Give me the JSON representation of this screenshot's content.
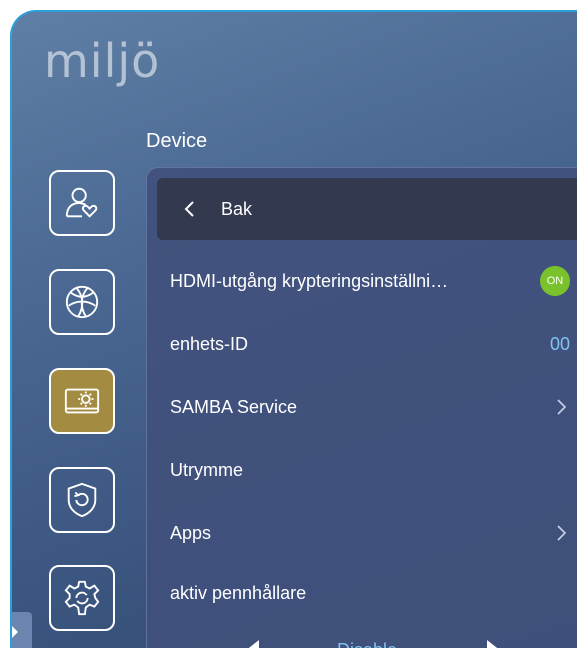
{
  "app": {
    "title": "miljö"
  },
  "section": {
    "title": "Device"
  },
  "sidebar": {
    "items": [
      {
        "name": "user-heart-icon",
        "active": false
      },
      {
        "name": "globe-network-icon",
        "active": false
      },
      {
        "name": "device-settings-icon",
        "active": true
      },
      {
        "name": "shield-restore-icon",
        "active": false
      },
      {
        "name": "gear-refresh-icon",
        "active": false
      }
    ]
  },
  "panel": {
    "back_label": "Bak",
    "rows": [
      {
        "label": "HDMI-utgång krypteringsinställni…",
        "toggle": "ON"
      },
      {
        "label": "enhets-ID",
        "value": "00"
      },
      {
        "label": "SAMBA Service"
      },
      {
        "label": "Utrymme"
      },
      {
        "label": "Apps"
      },
      {
        "label": "aktiv pennhållare"
      }
    ],
    "pen_holder_value": "Disable"
  },
  "colors": {
    "accent_active": "#a48b42",
    "toggle_on": "#7ac22b",
    "value_text": "#7fc4ee"
  }
}
